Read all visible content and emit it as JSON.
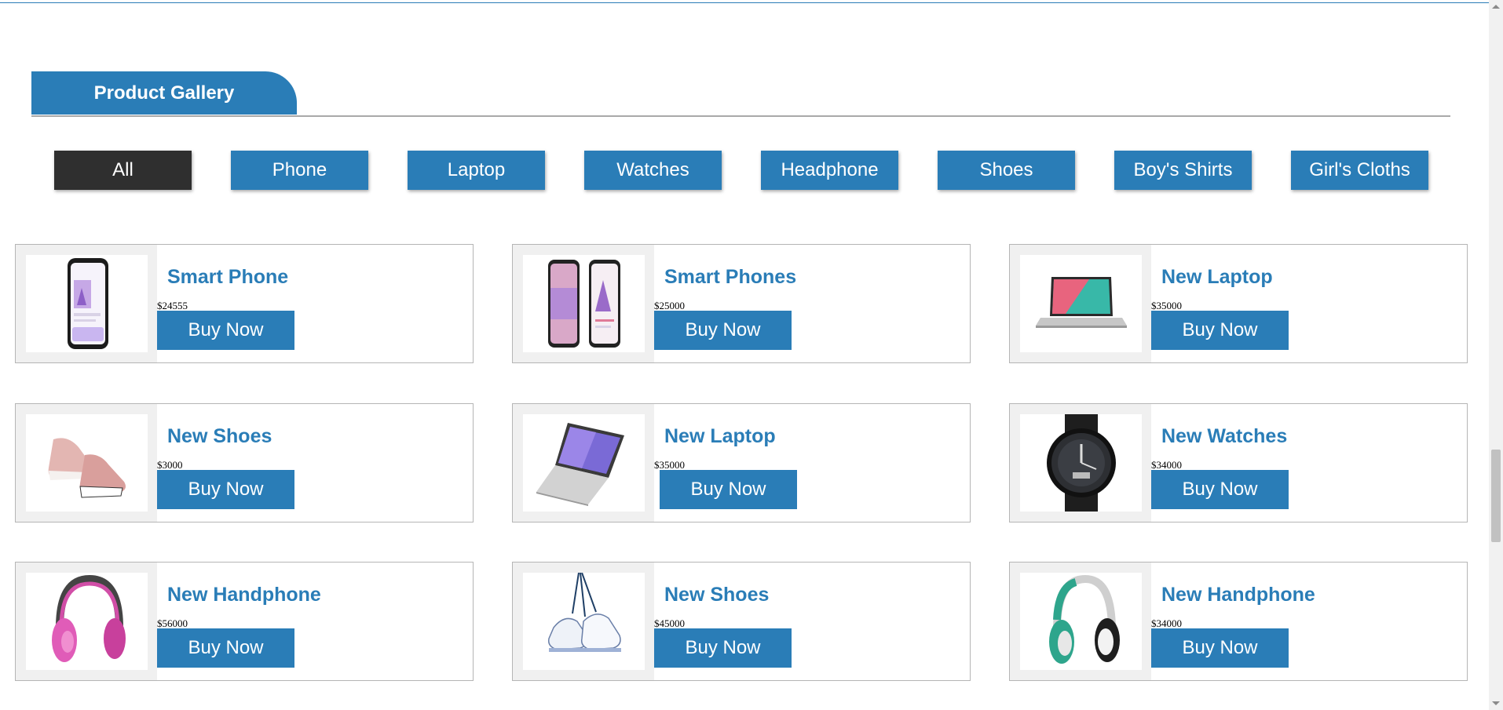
{
  "gallery": {
    "title": "Product Gallery"
  },
  "filters": [
    {
      "label": "All",
      "active": true
    },
    {
      "label": "Phone",
      "active": false
    },
    {
      "label": "Laptop",
      "active": false
    },
    {
      "label": "Watches",
      "active": false
    },
    {
      "label": "Headphone",
      "active": false
    },
    {
      "label": "Shoes",
      "active": false
    },
    {
      "label": "Boy's Shirts",
      "active": false
    },
    {
      "label": "Girl's Cloths",
      "active": false
    }
  ],
  "products": [
    {
      "name": "Smart Phone",
      "price": "$24555",
      "button": "Buy Now",
      "image": "phone-image"
    },
    {
      "name": "Smart Phones",
      "price": "$25000",
      "button": "Buy Now",
      "image": "phones-image"
    },
    {
      "name": "New Laptop",
      "price": "$35000",
      "button": "Buy Now",
      "image": "laptop-image"
    },
    {
      "name": "New Shoes",
      "price": "$3000",
      "button": "Buy Now",
      "image": "shoes-image"
    },
    {
      "name": "New Laptop",
      "price": "$35000",
      "button": "Buy Now",
      "image": "laptop-image"
    },
    {
      "name": "New Watches",
      "price": "$34000",
      "button": "Buy Now",
      "image": "watch-image"
    },
    {
      "name": "New Handphone",
      "price": "$56000",
      "button": "Buy Now",
      "image": "headphone-image"
    },
    {
      "name": "New Shoes",
      "price": "$45000",
      "button": "Buy Now",
      "image": "shoes-image"
    },
    {
      "name": "New Handphone",
      "price": "$34000",
      "button": "Buy Now",
      "image": "headphone-image"
    }
  ],
  "colors": {
    "accent": "#2a7db7",
    "active_filter": "#2f2f2f",
    "card_border": "#b5b5b5",
    "thumb_bg": "#f0f0f0"
  }
}
